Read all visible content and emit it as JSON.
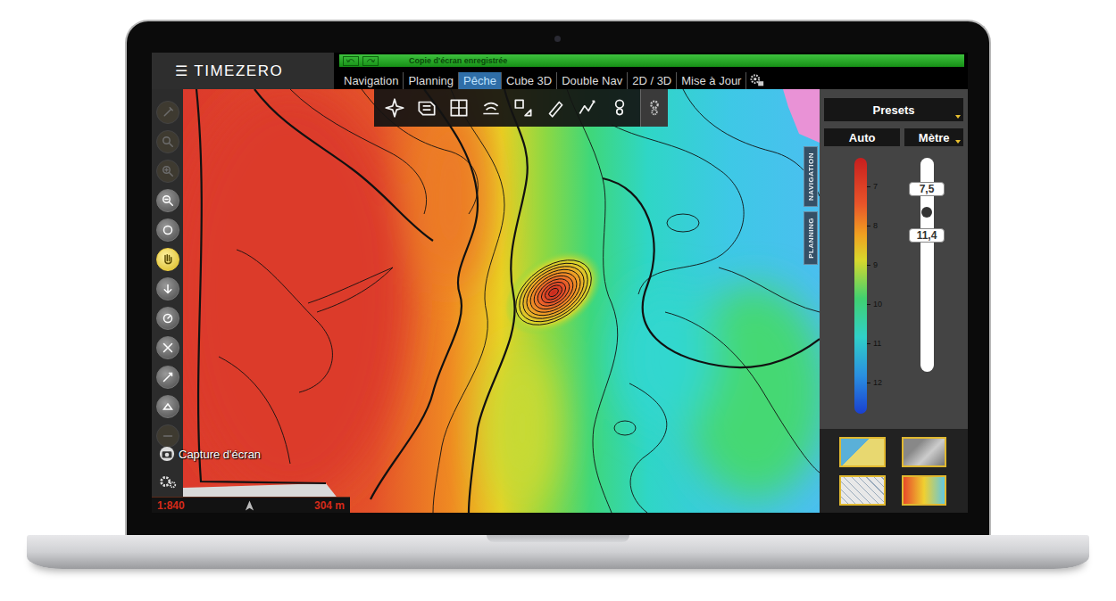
{
  "app": {
    "logo_icon": "☰",
    "logo": "TIMEZERO"
  },
  "status_message": "Copie d'écran enregistrée",
  "tabs": [
    {
      "label": "Navigation",
      "selected": false
    },
    {
      "label": "Planning",
      "selected": false
    },
    {
      "label": "Pêche",
      "selected": true
    },
    {
      "label": "Cube 3D",
      "selected": false
    },
    {
      "label": "Double Nav",
      "selected": false
    },
    {
      "label": "2D / 3D",
      "selected": false
    },
    {
      "label": "Mise à Jour",
      "selected": false
    }
  ],
  "left_toolbar": [
    {
      "disabled": true,
      "selected": false
    },
    {
      "disabled": true,
      "selected": false
    },
    {
      "disabled": true,
      "selected": false
    },
    {
      "disabled": false,
      "selected": false
    },
    {
      "disabled": false,
      "selected": false
    },
    {
      "disabled": false,
      "selected": true
    },
    {
      "disabled": false,
      "selected": false
    },
    {
      "disabled": false,
      "selected": false
    },
    {
      "disabled": false,
      "selected": false
    },
    {
      "disabled": false,
      "selected": false
    },
    {
      "disabled": false,
      "selected": false
    },
    {
      "disabled": true,
      "selected": false
    }
  ],
  "side_tabs": [
    {
      "label": "NAVIGATION",
      "selected": false
    },
    {
      "label": "PLANNING",
      "selected": false
    }
  ],
  "panel": {
    "presets": "Presets",
    "mode": "Auto",
    "unit": "Mètre"
  },
  "depth_scale": {
    "ticks": [
      "7",
      "8",
      "9",
      "10",
      "11",
      "12"
    ]
  },
  "depth_slider": {
    "handles": [
      {
        "reading": "7,5",
        "level": 0.82
      },
      {
        "reading": "11,4",
        "level": 0.67
      }
    ]
  },
  "screenshot_button": {
    "label": "Capture d'écran"
  },
  "scale_bar": {
    "ratio": "1:840",
    "distance": "304 m"
  }
}
